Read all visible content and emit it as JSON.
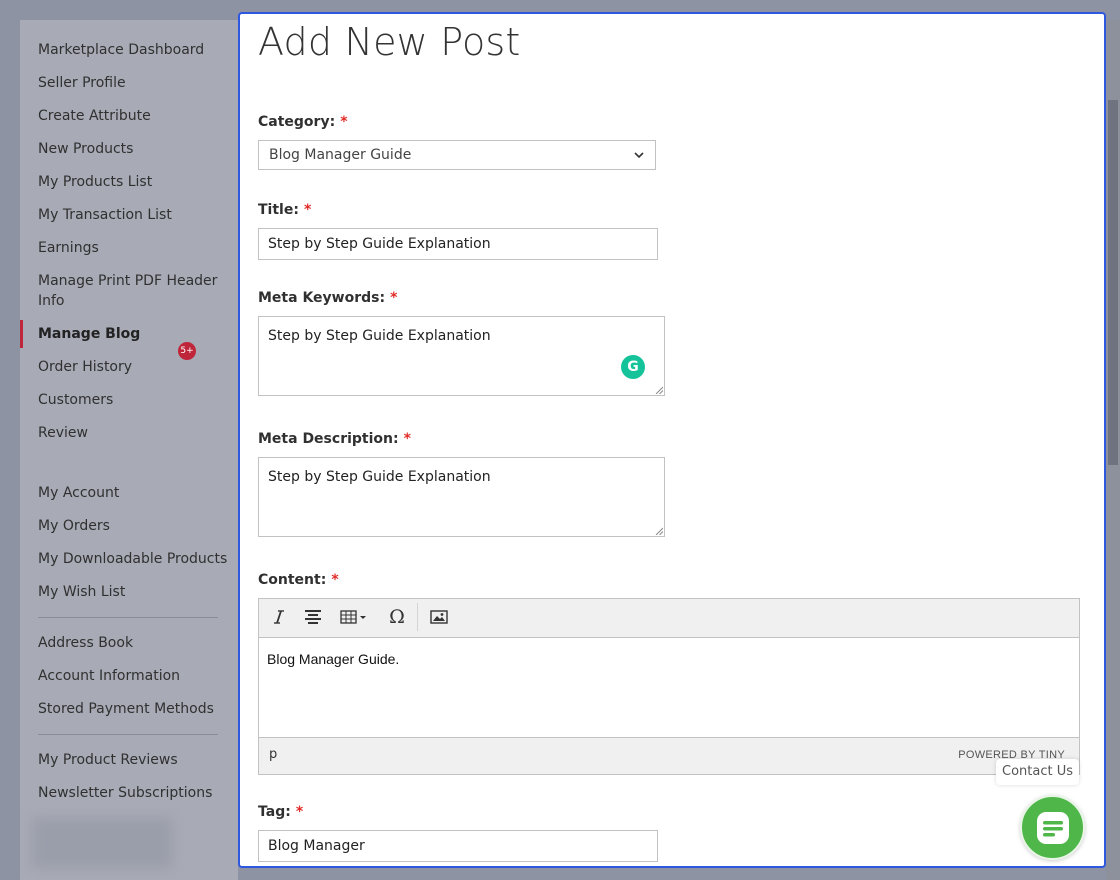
{
  "sidebar": {
    "items": [
      {
        "label": "Marketplace Dashboard"
      },
      {
        "label": "Seller Profile"
      },
      {
        "label": "Create Attribute"
      },
      {
        "label": "New Products"
      },
      {
        "label": "My Products List"
      },
      {
        "label": "My Transaction List"
      },
      {
        "label": "Earnings"
      },
      {
        "label": "Manage Print PDF Header Info"
      },
      {
        "label": "Manage Blog",
        "active": true
      },
      {
        "label": "Order History"
      },
      {
        "label": "Customers"
      },
      {
        "label": "Review"
      }
    ],
    "badge": "5+",
    "account_items": [
      {
        "label": "My Account"
      },
      {
        "label": "My Orders"
      },
      {
        "label": "My Downloadable Products"
      },
      {
        "label": "My Wish List"
      },
      {
        "label": "Address Book"
      },
      {
        "label": "Account Information"
      },
      {
        "label": "Stored Payment Methods"
      },
      {
        "label": "My Product Reviews"
      },
      {
        "label": "Newsletter Subscriptions"
      }
    ]
  },
  "modal": {
    "title": "Add New Post",
    "required_marker": "*",
    "category": {
      "label": "Category:",
      "value": "Blog Manager Guide"
    },
    "title_field": {
      "label": "Title:",
      "value": "Step by Step Guide Explanation"
    },
    "meta_keywords": {
      "label": "Meta Keywords:",
      "value": "Step by Step Guide Explanation"
    },
    "meta_description": {
      "label": "Meta Description:",
      "value": "Step by Step Guide Explanation"
    },
    "content": {
      "label": "Content:",
      "body": "Blog Manager Guide.",
      "status_path": "p",
      "powered_by": "POWERED BY TINY"
    },
    "tag": {
      "label": "Tag:",
      "value": "Blog Manager"
    }
  },
  "contact": {
    "tooltip": "Contact Us"
  },
  "colors": {
    "accent": "#2f58e0",
    "required": "#e02b27",
    "contact_green": "#4fb749",
    "badge_red": "#c0263a"
  }
}
